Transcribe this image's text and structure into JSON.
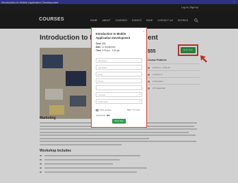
{
  "browser": {
    "title": "Introduction to Mobile Application Development",
    "menu_dots": "⋮"
  },
  "topbar": {
    "login": "Log in  |  Sign Up"
  },
  "header": {
    "logo": "COURSES",
    "nav": [
      "HOME",
      "ABOUT",
      "COURSES",
      "EVENTS",
      "PAGE",
      "CONTACT US",
      "ENTRIES"
    ]
  },
  "course": {
    "title_left": "Introduction to Mobi",
    "title_right": "ent",
    "price": "$55",
    "book_label": "Book Now",
    "features_title": "Course Features",
    "features": [
      "10:00 pm - 9:30 pm",
      "Lectures 3",
      "10 Duration",
      "All Categories"
    ],
    "section_marketing": "Marketing",
    "section_workshop": "Workshop Includes"
  },
  "modal": {
    "title": "Introduction to Mobile Application Development",
    "cost_label": "Cost:",
    "cost_value": "$55",
    "date_label": "Date:",
    "date_value": "11 September",
    "time_label": "Time:",
    "time_value": "9:30 pm - 9:30 pm",
    "fields": [
      "First Name",
      "Last Name",
      "Email",
      "Phone",
      "",
      "",
      ""
    ],
    "select_person": "1 Person",
    "select_payment": "Credit Card",
    "card_number_label": "Card number",
    "card_expiry_label": "MM / YY  CVC",
    "total_label": "Total Price:",
    "total_value": "$55",
    "submit_label": "Book Now",
    "close": "×"
  },
  "colors": {
    "accent_green": "#2e9d4a",
    "highlight_red": "#e03a2a",
    "header_bg": "#1f1f1f",
    "browser_bar": "#3a3ca8"
  }
}
